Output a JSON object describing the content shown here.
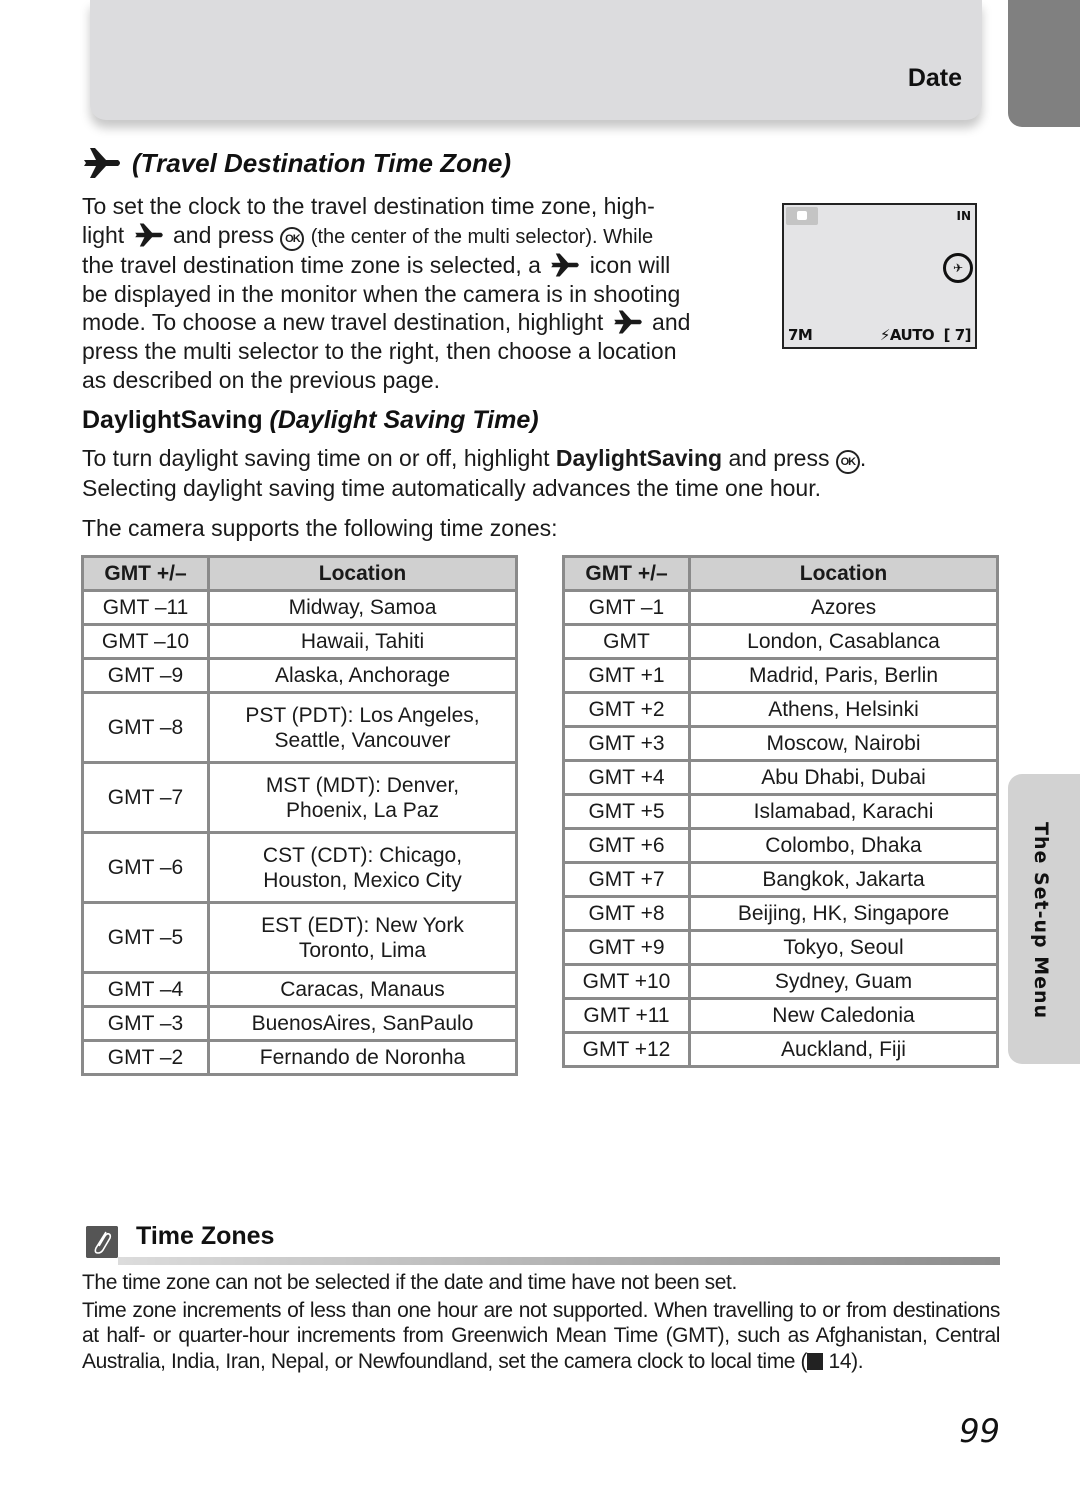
{
  "header": {
    "title": "Date"
  },
  "side_tab": {
    "label": "The Set-up Menu"
  },
  "travel_section": {
    "icon": "airplane-icon",
    "heading": "(Travel Destination Time Zone)",
    "para_1": "To set the clock to the travel destination time zone, high-",
    "para_2a": "light",
    "para_2b": " and press ",
    "para_2c": " (the center of the multi selector). While",
    "para_3a": "the travel destination time zone is selected, a",
    "para_3b": " icon will",
    "para_4": "be displayed in the monitor when the camera is in shooting",
    "para_5a": "mode. To choose a new travel destination, highlight",
    "para_5b": " and",
    "para_6": "press the multi selector to the right, then choose a location",
    "para_7": "as described on the previous page.",
    "ok_label": "OK"
  },
  "monitor": {
    "storage": "IN",
    "travel_symbol": "✈",
    "image_size": "7M",
    "flash": "⚡AUTO",
    "frames": "[  7]"
  },
  "dst_section": {
    "heading_bold": "DaylightSaving",
    "heading_italic": "(Daylight Saving Time)",
    "para_a": "To turn daylight saving time on or off, highlight ",
    "para_bold": "DaylightSaving",
    "para_b": " and press ",
    "para_c": ".",
    "para_2": "Selecting daylight saving time automatically advances the time one hour.",
    "supports": "The camera supports the following time zones:"
  },
  "table": {
    "headers": [
      "GMT +/–",
      "Location"
    ],
    "left_rows": [
      {
        "gmt": "GMT –11",
        "loc": "Midway, Samoa",
        "loc2": ""
      },
      {
        "gmt": "GMT –10",
        "loc": "Hawaii, Tahiti",
        "loc2": ""
      },
      {
        "gmt": "GMT –9",
        "loc": "Alaska, Anchorage",
        "loc2": ""
      },
      {
        "gmt": "GMT –8",
        "loc": "PST (PDT): Los Angeles,",
        "loc2": "Seattle, Vancouver"
      },
      {
        "gmt": "GMT –7",
        "loc": "MST (MDT): Denver,",
        "loc2": "Phoenix, La Paz"
      },
      {
        "gmt": "GMT –6",
        "loc": "CST (CDT): Chicago,",
        "loc2": "Houston, Mexico City"
      },
      {
        "gmt": "GMT –5",
        "loc": "EST (EDT): New York",
        "loc2": "Toronto, Lima"
      },
      {
        "gmt": "GMT –4",
        "loc": "Caracas, Manaus",
        "loc2": ""
      },
      {
        "gmt": "GMT –3",
        "loc": "BuenosAires, SanPaulo",
        "loc2": ""
      },
      {
        "gmt": "GMT –2",
        "loc": "Fernando de Noronha",
        "loc2": ""
      }
    ],
    "right_rows": [
      {
        "gmt": "GMT –1",
        "loc": "Azores"
      },
      {
        "gmt": "GMT",
        "loc": "London, Casablanca"
      },
      {
        "gmt": "GMT +1",
        "loc": "Madrid, Paris, Berlin"
      },
      {
        "gmt": "GMT +2",
        "loc": "Athens, Helsinki"
      },
      {
        "gmt": "GMT +3",
        "loc": "Moscow, Nairobi"
      },
      {
        "gmt": "GMT +4",
        "loc": "Abu Dhabi, Dubai"
      },
      {
        "gmt": "GMT +5",
        "loc": "Islamabad, Karachi"
      },
      {
        "gmt": "GMT +6",
        "loc": "Colombo, Dhaka"
      },
      {
        "gmt": "GMT +7",
        "loc": "Bangkok, Jakarta"
      },
      {
        "gmt": "GMT +8",
        "loc": "Beijing, HK, Singapore"
      },
      {
        "gmt": "GMT +9",
        "loc": "Tokyo, Seoul"
      },
      {
        "gmt": "GMT +10",
        "loc": "Sydney, Guam"
      },
      {
        "gmt": "GMT +11",
        "loc": "New Caledonia"
      },
      {
        "gmt": "GMT +12",
        "loc": "Auckland, Fiji"
      }
    ]
  },
  "note": {
    "icon": "paperclip-icon",
    "title": "Time Zones",
    "para_1": "The time zone can not be selected if the date and time have not been set.",
    "para_2a": "Time zone increments of less than one hour are not supported. When travelling to or from destinations at half- or quarter-hour increments from Greenwich Mean Time (GMT), such as Afghanistan, Central Australia, India, Iran, Nepal, or Newfoundland, set the camera clock to local time (",
    "para_2_ref": "14",
    "para_2b": ")."
  },
  "page_number": "99"
}
